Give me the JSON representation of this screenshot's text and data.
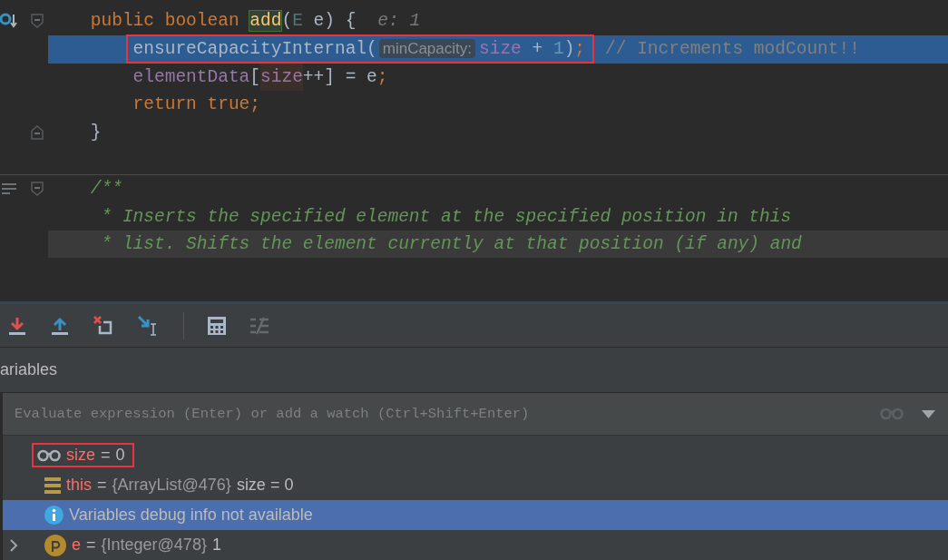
{
  "editor": {
    "lines": [
      {
        "kind": "signature",
        "gutter": [
          {
            "kind": "override"
          },
          {
            "kind": "fold-start"
          }
        ],
        "current": false,
        "shaded": false,
        "tokens": [
          {
            "kind": "keyword",
            "text": "public boolean "
          },
          {
            "kind": "method-decl",
            "text": "add"
          },
          {
            "kind": "plain",
            "text": "("
          },
          {
            "kind": "type-param",
            "text": "E"
          },
          {
            "kind": "plain",
            "text": " e) {"
          },
          {
            "kind": "hint",
            "text": "e: 1"
          }
        ]
      },
      {
        "kind": "body",
        "current": true,
        "shaded": false,
        "tokens": [
          {
            "kind": "box",
            "tokens": [
              {
                "kind": "plain",
                "text": "ensureCapacityInternal("
              },
              {
                "kind": "param-hint",
                "text": "minCapacity:"
              },
              {
                "kind": "field",
                "text": "size"
              },
              {
                "kind": "plain",
                "text": " + "
              },
              {
                "kind": "number",
                "text": "1"
              },
              {
                "kind": "plain",
                "text": ")"
              },
              {
                "kind": "keyword",
                "text": ";"
              }
            ]
          },
          {
            "kind": "comment",
            "text": "// Increments modCount!!"
          }
        ]
      },
      {
        "kind": "body",
        "current": false,
        "shaded": false,
        "tokens": [
          {
            "kind": "field",
            "text": "elementData"
          },
          {
            "kind": "plain",
            "text": "["
          },
          {
            "kind": "field-usage",
            "text": "size"
          },
          {
            "kind": "plain",
            "text": "++] = e"
          },
          {
            "kind": "keyword",
            "text": ";"
          }
        ]
      },
      {
        "kind": "body",
        "current": false,
        "shaded": false,
        "tokens": [
          {
            "kind": "keyword",
            "text": "return true;"
          }
        ]
      },
      {
        "kind": "signature",
        "gutter": [
          {
            "kind": "fold-end"
          }
        ],
        "current": false,
        "shaded": false,
        "tokens": [
          {
            "kind": "plain",
            "text": "}"
          }
        ]
      },
      {
        "kind": "blank",
        "current": false,
        "shaded": false
      },
      {
        "kind": "signature",
        "gutter": [
          {
            "kind": "doc"
          },
          {
            "kind": "fold-start"
          }
        ],
        "current": false,
        "shaded": false,
        "tokens": [
          {
            "kind": "doc",
            "text": "/**"
          }
        ]
      },
      {
        "kind": "doc-body",
        "current": false,
        "shaded": false,
        "tokens": [
          {
            "kind": "doc",
            "text": "* Inserts the specified element at the specified position in this"
          }
        ]
      },
      {
        "kind": "doc-body",
        "current": false,
        "shaded": true,
        "tokens": [
          {
            "kind": "doc",
            "text": "* list. Shifts the element currently at that position (if any) and"
          }
        ]
      }
    ]
  },
  "debugger": {
    "toolbar": [
      {
        "kind": "step-into-red"
      },
      {
        "kind": "step-out"
      },
      {
        "kind": "drop-frame"
      },
      {
        "kind": "run-to-cursor"
      },
      {
        "kind": "separator"
      },
      {
        "kind": "evaluate"
      },
      {
        "kind": "trace"
      }
    ],
    "panel_title": "ariables",
    "expression_field": {
      "placeholder": "Evaluate expression (Enter) or add a watch (Ctrl+Shift+Enter)"
    },
    "variables": [
      {
        "kind": "watch",
        "name": "size",
        "equals": "=",
        "value": "0",
        "selected": false,
        "boxed": true
      },
      {
        "kind": "object",
        "name": "this",
        "equals": "=",
        "value": "{ArrayList@476}",
        "extra": "size = 0",
        "selected": false,
        "boxed": false
      },
      {
        "kind": "info",
        "value": "Variables debug info not available",
        "selected": true,
        "boxed": false
      },
      {
        "kind": "param",
        "name": "e",
        "equals": "=",
        "value": "{Integer@478}",
        "extra": "1",
        "selected": false,
        "boxed": false,
        "expanded": false
      }
    ]
  }
}
